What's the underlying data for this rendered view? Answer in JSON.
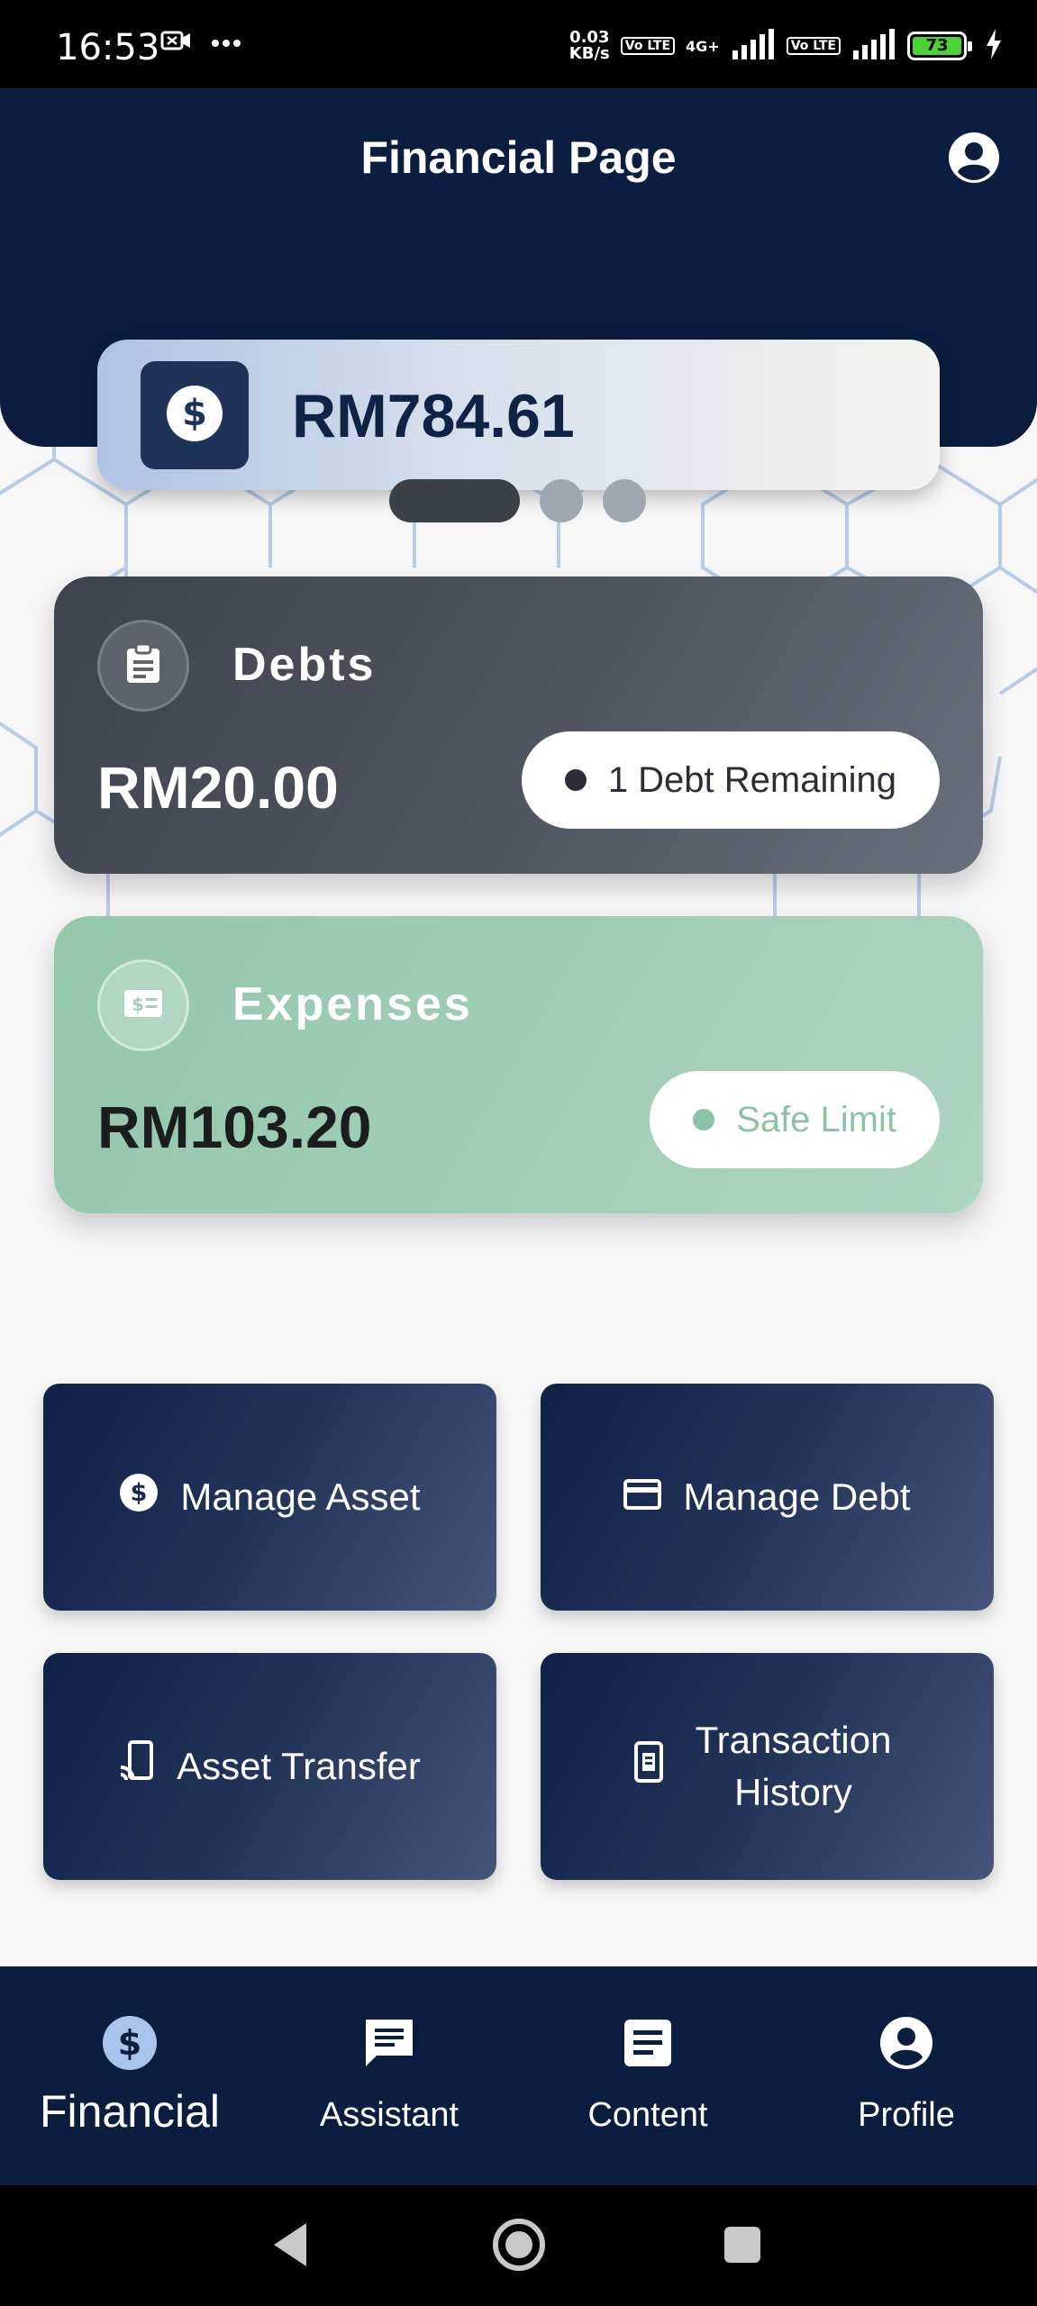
{
  "status_bar": {
    "time": "16:53",
    "network_speed_top": "0.03",
    "network_speed_bottom": "KB/s",
    "volte_label": "Vo LTE",
    "network_type": "4G+",
    "battery_level": "73",
    "icons": [
      "screen-record-icon",
      "more-icon",
      "signal-icon",
      "signal-icon",
      "charging-icon"
    ]
  },
  "header": {
    "title": "Financial Page",
    "profile_icon": "account-circle-icon",
    "balance": {
      "amount": "RM784.61",
      "icon": "dollar-circle-icon"
    }
  },
  "pager": {
    "pages": 3,
    "active_index": 0
  },
  "cards": {
    "debts": {
      "title": "Debts",
      "amount": "RM20.00",
      "badge": "1 Debt Remaining",
      "icon": "clipboard-icon"
    },
    "expenses": {
      "title": "Expenses",
      "amount": "RM103.20",
      "badge": "Safe Limit",
      "icon": "money-icon"
    }
  },
  "actions": {
    "manage_asset": "Manage Asset",
    "manage_debt": "Manage Debt",
    "asset_transfer": "Asset Transfer",
    "transaction_history": "Transaction History"
  },
  "bottom_nav": {
    "items": [
      {
        "label": "Financial",
        "icon": "dollar-circle-icon",
        "active": true
      },
      {
        "label": "Assistant",
        "icon": "chat-icon",
        "active": false
      },
      {
        "label": "Content",
        "icon": "article-icon",
        "active": false
      },
      {
        "label": "Profile",
        "icon": "account-circle-icon",
        "active": false
      }
    ]
  },
  "colors": {
    "navy": "#0c1e3f",
    "debt_card": "#4a4e58",
    "expense_card": "#9ccbb3",
    "active_nav_icon": "#a9c4ec"
  }
}
